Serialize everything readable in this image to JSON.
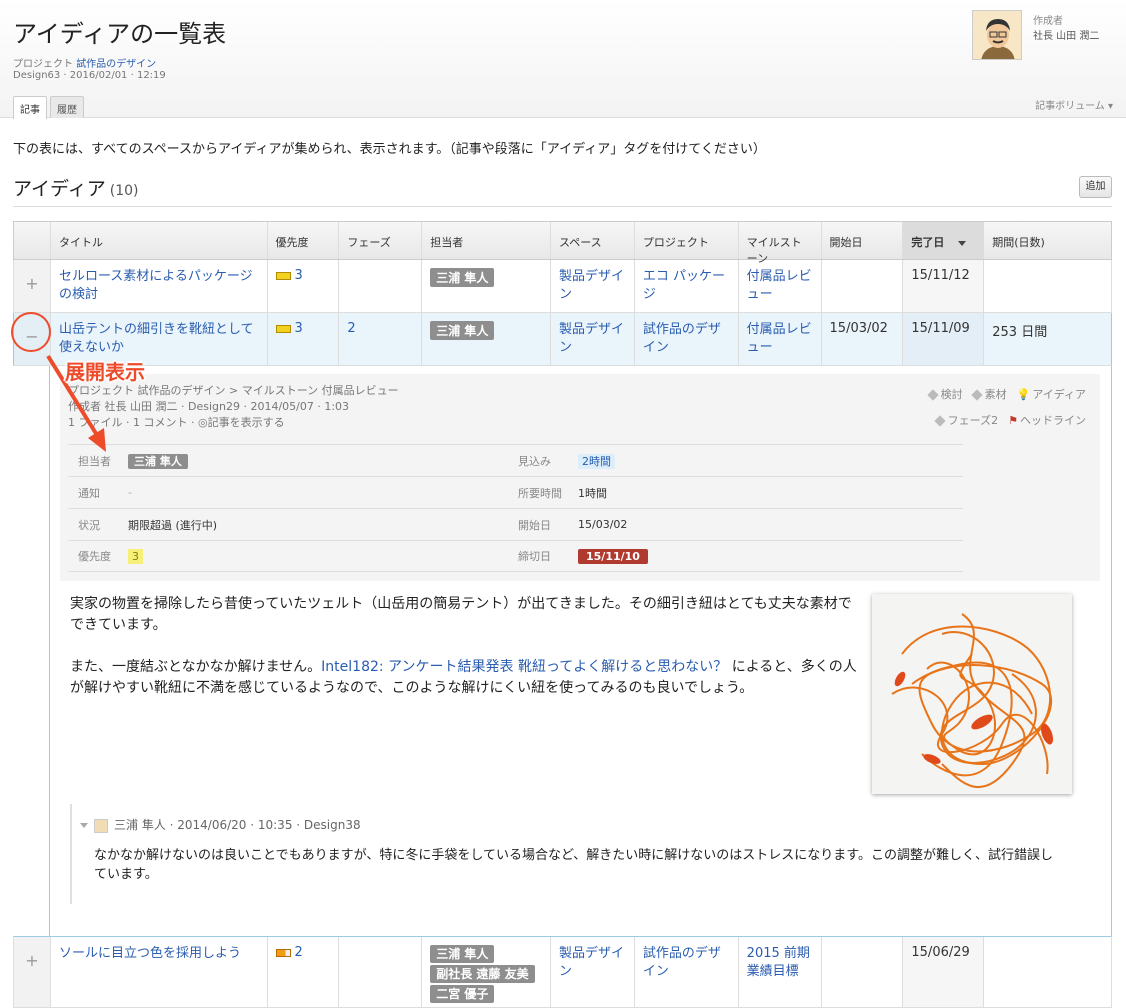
{
  "page": {
    "title": "アイディアの一覧表",
    "project_label": "プロジェクト",
    "project_name": "試作品のデザイン",
    "meta": "Design63 · 2016/02/01 · 12:19",
    "tabs": [
      "記事",
      "履歴"
    ],
    "volume": "記事ボリューム",
    "author_label": "作成者",
    "author_name": "社長 山田 潤二"
  },
  "intro": "下の表には、すべてのスペースからアイディアが集められ、表示されます。（記事や段落に「アイディア」タグを付けてください）",
  "section": {
    "title": "アイディア",
    "count": "(10)",
    "add_button": "追加"
  },
  "table": {
    "headers": [
      "タイトル",
      "優先度",
      "フェーズ",
      "担当者",
      "スペース",
      "プロジェクト",
      "マイルストーン",
      "開始日",
      "完了日",
      "期間(日数)"
    ],
    "rows": [
      {
        "toggle": "+",
        "title": "セルロース素材によるパッケージの検討",
        "priority": "3",
        "priority_color": "#f2d21e",
        "phase": "",
        "assignees": [
          "三浦 隼人"
        ],
        "space": "製品デザイン",
        "project": "エコ パッケージ",
        "milestone": "付属品レビュー",
        "start": "",
        "end": "15/11/12",
        "duration": ""
      },
      {
        "toggle": "−",
        "title": "山岳テントの細引きを靴紐として使えないか",
        "priority": "3",
        "priority_color": "#f2d21e",
        "phase": "2",
        "assignees": [
          "三浦 隼人"
        ],
        "space": "製品デザイン",
        "project": "試作品のデザイン",
        "milestone": "付属品レビュー",
        "start": "15/03/02",
        "end": "15/11/09",
        "duration": "253 日間"
      },
      {
        "toggle": "+",
        "title": "ソールに目立つ色を採用しよう",
        "priority": "2",
        "priority_color": "#f39c12",
        "phase": "",
        "assignees": [
          "三浦 隼人",
          "副社長 遠藤 友美",
          "二宮 優子"
        ],
        "space": "製品デザイン",
        "project": "試作品のデザイン",
        "milestone": "2015 前期 業績目標",
        "start": "",
        "end": "15/06/29",
        "duration": ""
      }
    ]
  },
  "detail": {
    "breadcrumb": "プロジェクト 試作品のデザイン > マイルストーン 付属品レビュー",
    "byline": "作成者 社長 山田 潤二 · Design29 · 2014/05/07 · 1:03",
    "attachments": "1 ファイル · 1 コメント · ◎記事を表示する",
    "tags_row1": [
      "検討",
      "素材",
      "アイディア"
    ],
    "tags_row2": [
      "フェーズ2",
      "ヘッドライン"
    ],
    "props": {
      "assignee_label": "担当者",
      "assignee": "三浦 隼人",
      "estimate_label": "見込み",
      "estimate": "2時間",
      "notify_label": "通知",
      "notify": "-",
      "spent_label": "所要時間",
      "spent": "1時間",
      "status_label": "状況",
      "status": "期限超過 (進行中)",
      "start_label": "開始日",
      "start": "15/03/02",
      "priority_label": "優先度",
      "priority": "3",
      "due_label": "締切日",
      "due": "15/11/10"
    },
    "body_p1": "実家の物置を掃除したら昔使っていたツェルト（山岳用の簡易テント）が出てきました。その細引き紐はとても丈夫な素材でできています。",
    "body_p2_pre": "また、一度結ぶとなかなか解けません。",
    "body_p2_link": "Intel182: アンケート結果発表 靴紐ってよく解けると思わない？",
    "body_p2_post": " によると、多くの人が解けやすい靴紐に不満を感じているようなので、このような解けにくい紐を使ってみるのも良いでしょう。",
    "comment_head": "三浦 隼人 · 2014/06/20 · 10:35 · Design38",
    "comment_body": "なかなか解けないのは良いことでもありますが、特に冬に手袋をしている場合など、解きたい時に解けないのはストレスになります。この調整が難しく、試行錯誤しています。"
  },
  "annotation": {
    "label": "展開表示",
    "color": "#ee4b2b"
  }
}
